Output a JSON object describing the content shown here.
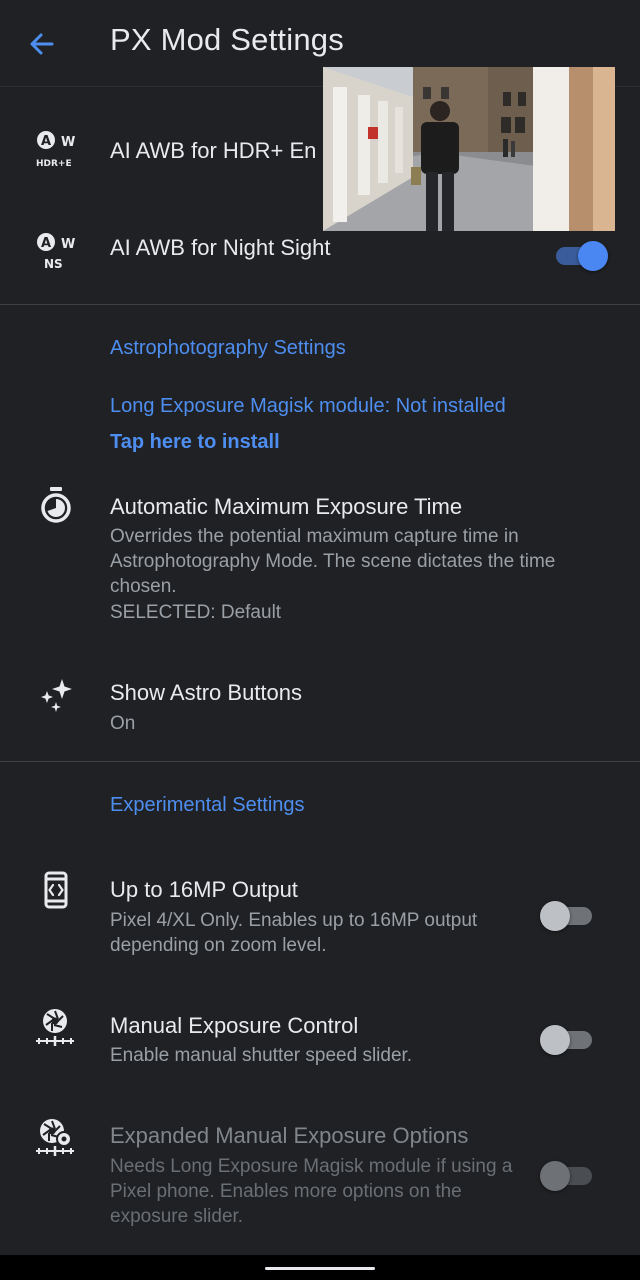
{
  "app_bar": {
    "title": "PX Mod Settings",
    "back_icon": "arrow-back-icon",
    "accent_color": "#4e8ef0"
  },
  "rows_top": [
    {
      "icon": "awb-hdr-icon",
      "icon_label": "HDR+E",
      "title": "AI AWB for HDR+ En"
    },
    {
      "icon": "awb-ns-icon",
      "icon_label": "NS",
      "title": "AI AWB for Night Sight",
      "toggle": true
    }
  ],
  "astro": {
    "header": "Astrophotography Settings",
    "module_status": "Long Exposure Magisk module: Not installed",
    "install_link": "Tap here to install",
    "exposure": {
      "title": "Automatic Maximum Exposure Time",
      "description": "Overrides the potential maximum capture time in Astrophotography Mode. The scene dictates the time chosen.",
      "selected": "SELECTED: Default",
      "icon": "timer-icon"
    },
    "buttons": {
      "title": "Show Astro Buttons",
      "value": "On",
      "icon": "sparkles-icon"
    }
  },
  "experimental": {
    "header": "Experimental Settings",
    "items": [
      {
        "title": "Up to 16MP Output",
        "description": "Pixel 4/XL Only. Enables up to 16MP output depending on zoom level.",
        "icon": "phone-code-icon",
        "toggle": false,
        "enabled": true
      },
      {
        "title": "Manual Exposure Control",
        "description": "Enable manual shutter speed slider.",
        "icon": "shutter-slider-icon",
        "toggle": false,
        "enabled": true
      },
      {
        "title": "Expanded Manual Exposure Options",
        "description": "Needs Long Exposure Magisk module if using a Pixel phone. Enables more options on the exposure slider.",
        "icon": "shutter-gear-icon",
        "toggle": false,
        "enabled": false
      }
    ]
  },
  "overlay_photo": {
    "description_icon": "camera-preview-thumbnail"
  }
}
